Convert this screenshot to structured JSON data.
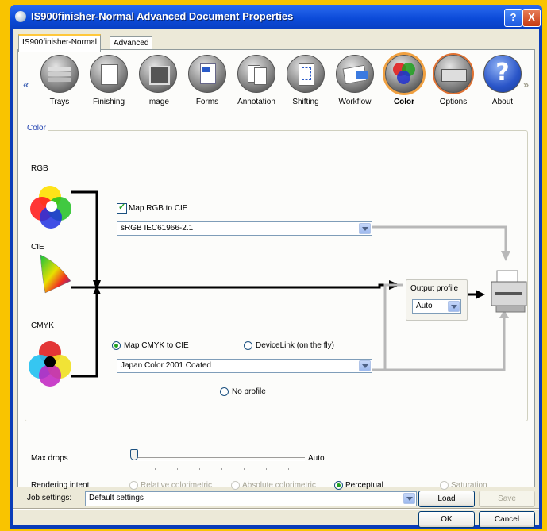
{
  "window": {
    "title": "IS900finisher-Normal Advanced Document Properties",
    "help_btn": "?",
    "close_btn": "X"
  },
  "tabs": [
    {
      "label": "IS900finisher-Normal",
      "active": true
    },
    {
      "label": "Advanced",
      "active": false
    }
  ],
  "nav": {
    "prev": "«",
    "next": "»"
  },
  "tools": [
    {
      "label": "Trays",
      "icon": "trays-icon"
    },
    {
      "label": "Finishing",
      "icon": "finishing-icon"
    },
    {
      "label": "Image",
      "icon": "image-icon"
    },
    {
      "label": "Forms",
      "icon": "forms-icon"
    },
    {
      "label": "Annotation",
      "icon": "annotation-icon"
    },
    {
      "label": "Shifting",
      "icon": "shifting-icon"
    },
    {
      "label": "Workflow",
      "icon": "workflow-icon"
    },
    {
      "label": "Color",
      "icon": "color-icon",
      "selected": true
    },
    {
      "label": "Options",
      "icon": "options-icon"
    },
    {
      "label": "About",
      "icon": "about-icon"
    }
  ],
  "color_group": {
    "title": "Color",
    "rgb_label": "RGB",
    "cie_label": "CIE",
    "cmyk_label": "CMYK",
    "map_rgb": {
      "label": "Map RGB to CIE",
      "checked": true
    },
    "rgb_profile": "sRGB IEC61966-2.1",
    "map_cmyk": {
      "label": "Map CMYK to CIE",
      "selected": true
    },
    "devicelink": {
      "label": "DeviceLink (on the fly)",
      "selected": false
    },
    "cmyk_profile": "Japan Color 2001 Coated",
    "no_profile": {
      "label": "No profile",
      "selected": false
    },
    "output_profile": {
      "label": "Output profile",
      "value": "Auto"
    }
  },
  "max_drops": {
    "label": "Max drops",
    "value": "Auto"
  },
  "rendering_intent": {
    "label": "Rendering intent",
    "options": [
      {
        "label": "Relative colorimetric",
        "selected": false,
        "enabled": false
      },
      {
        "label": "Absolute colorimetric",
        "selected": false,
        "enabled": false
      },
      {
        "label": "Perceptual",
        "selected": true,
        "enabled": true
      },
      {
        "label": "Saturation",
        "selected": false,
        "enabled": false
      }
    ]
  },
  "job_settings": {
    "label": "Job settings:",
    "value": "Default settings",
    "load": "Load",
    "save": "Save"
  },
  "footer": {
    "ok": "OK",
    "cancel": "Cancel"
  },
  "colors": {
    "accent": "#0A3CB8",
    "check": "#21A121",
    "background": "#F9C400"
  }
}
